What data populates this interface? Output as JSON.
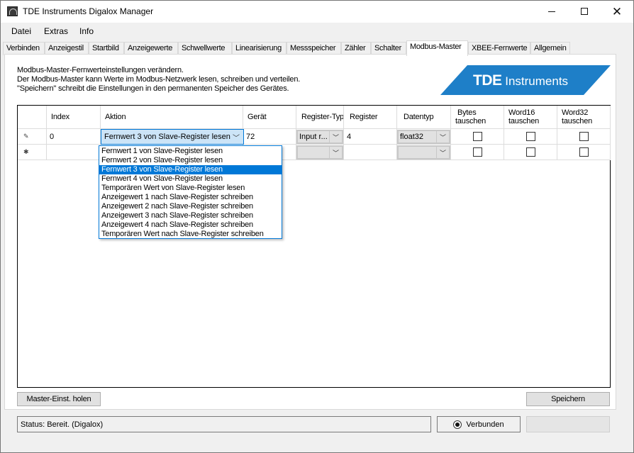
{
  "window": {
    "title": "TDE Instruments Digalox Manager",
    "icon": "app-gauge-icon",
    "controls": {
      "minimize": "minimize-icon",
      "maximize": "maximize-icon",
      "close": "close-icon"
    }
  },
  "menu": {
    "items": [
      {
        "label": "Datei"
      },
      {
        "label": "Extras"
      },
      {
        "label": "Info"
      }
    ]
  },
  "tabs": [
    {
      "label": "Verbinden"
    },
    {
      "label": "Anzeigestil"
    },
    {
      "label": "Startbild"
    },
    {
      "label": "Anzeigewerte"
    },
    {
      "label": "Schwellwerte"
    },
    {
      "label": "Linearisierung"
    },
    {
      "label": "Messspeicher"
    },
    {
      "label": "Zähler"
    },
    {
      "label": "Schalter"
    },
    {
      "label": "Modbus-Master",
      "active": true
    },
    {
      "label": "XBEE-Fernwerte"
    },
    {
      "label": "Allgemein"
    }
  ],
  "panel": {
    "description": [
      "Modbus-Master-Fernwerteinstellungen verändern.",
      "Der Modbus-Master kann Werte im Modbus-Netzwerk lesen, schreiben und verteilen.",
      "\"Speichern\" schreibt die Einstellungen in den permanenten Speicher des Gerätes."
    ],
    "logo": {
      "brand": "TDE",
      "suffix": "Instruments",
      "color": "#1e7fc8"
    }
  },
  "grid": {
    "columns": {
      "index": "Index",
      "aktion": "Aktion",
      "geraet": "Gerät",
      "register_typ": "Register-Typ",
      "register": "Register",
      "datentyp": "Datentyp",
      "bytes_1": "Bytes",
      "bytes_2": "tauschen",
      "word16_1": "Word16",
      "word16_2": "tauschen",
      "word32_1": "Word32",
      "word32_2": "tauschen"
    },
    "rows": [
      {
        "marker": "edit-pencil-icon",
        "index": "0",
        "aktion": "Fernwert 3 von Slave-Register lesen",
        "geraet": "72",
        "register_typ": "Input r...",
        "register": "4",
        "datentyp": "float32",
        "bytes_tauschen": false,
        "word16_tauschen": false,
        "word32_tauschen": false
      },
      {
        "marker": "new-row-asterisk-icon",
        "index": "",
        "aktion": "",
        "geraet": "",
        "register_typ": "",
        "register": "",
        "datentyp": "",
        "bytes_tauschen": false,
        "word16_tauschen": false,
        "word32_tauschen": false
      }
    ],
    "markers": {
      "edit": "✎",
      "new": "✱"
    },
    "dropdown": {
      "selected_index": 2,
      "options": [
        "Fernwert 1 von Slave-Register lesen",
        "Fernwert 2 von Slave-Register lesen",
        "Fernwert 3 von Slave-Register lesen",
        "Fernwert 4 von Slave-Register lesen",
        "Temporären Wert von Slave-Register lesen",
        "Anzeigewert 1 nach Slave-Register schreiben",
        "Anzeigewert 2 nach Slave-Register schreiben",
        "Anzeigewert 3 nach Slave-Register schreiben",
        "Anzeigewert 4 nach Slave-Register schreiben",
        "Temporären Wert nach Slave-Register schreiben"
      ]
    }
  },
  "buttons": {
    "fetch": "Master-Einst. holen",
    "save": "Speichern"
  },
  "statusbar": {
    "status": "Status: Bereit. (Digalox)",
    "connection": "Verbunden",
    "connected": true,
    "accent": "#0078d7"
  }
}
